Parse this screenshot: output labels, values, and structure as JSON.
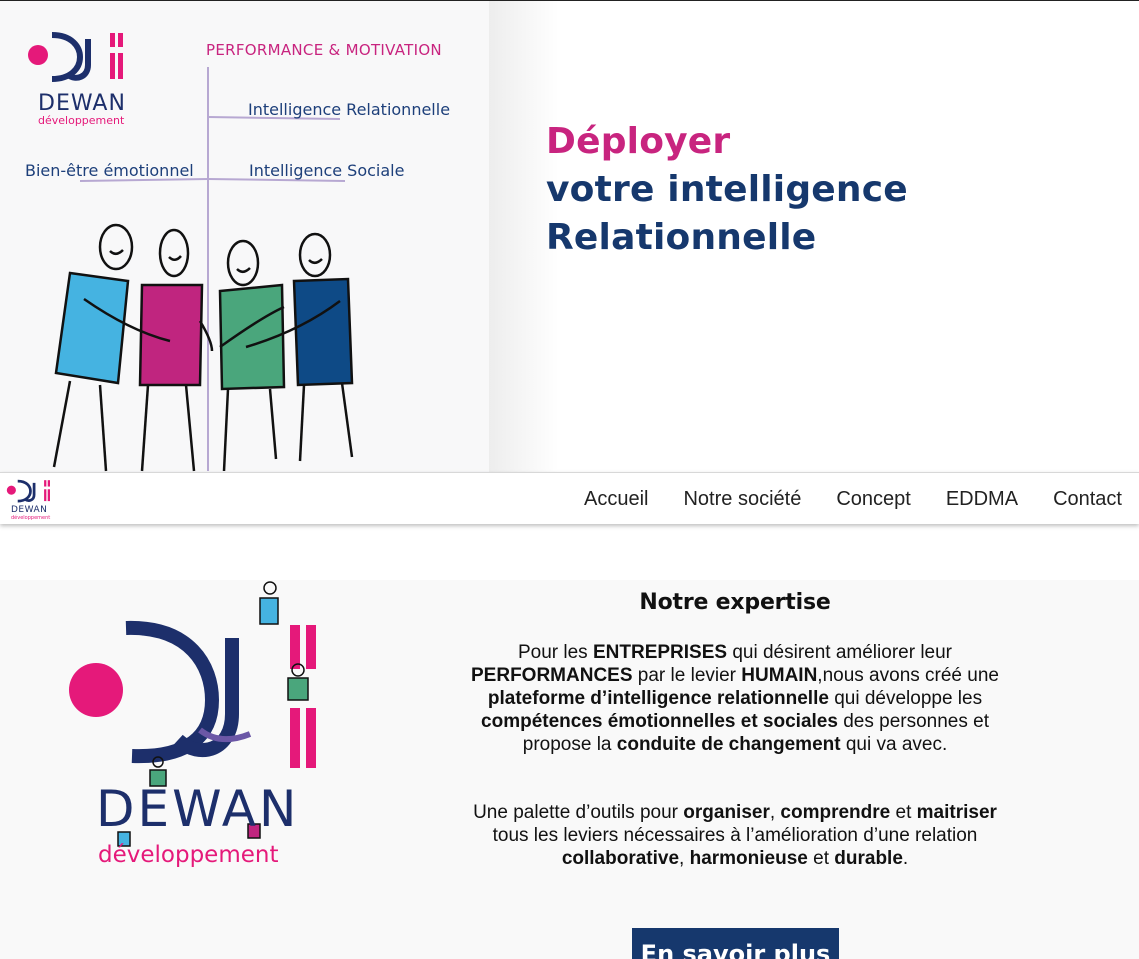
{
  "hero": {
    "illustration": {
      "logo_brand": "DEWAN",
      "logo_sub": "développement",
      "labels": {
        "performance": "PERFORMANCE & MOTIVATION",
        "relationnelle": "Intelligence Relationnelle",
        "bien_etre": "Bien-être émotionnel",
        "sociale": "Intelligence Sociale"
      }
    },
    "title_line1": "Déployer",
    "title_line2": "votre intelligence",
    "title_line3": "Relationnelle"
  },
  "nav": {
    "logo_brand": "DEWAN",
    "logo_sub": "développement",
    "items": [
      {
        "label": "Accueil"
      },
      {
        "label": "Notre société"
      },
      {
        "label": "Concept"
      },
      {
        "label": "EDDMA"
      },
      {
        "label": "Contact"
      }
    ]
  },
  "expertise": {
    "logo_brand": "DEWAN",
    "logo_sub": "développement",
    "title": "Notre expertise",
    "p1": {
      "t1": "Pour les ",
      "b1": "ENTREPRISES",
      "t2": " qui désirent améliorer leur ",
      "b2": "PERFORMANCES",
      "t3": " par le levier ",
      "b3": "HUMAIN",
      "t4": ",nous avons créé une ",
      "b4": "plateforme d’intelligence relationnelle",
      "t5": " qui développe les ",
      "b5": "compétences émotionnelles et sociales",
      "t6": " des personnes et propose la ",
      "b6": "conduite de changement",
      "t7": " qui va avec."
    },
    "p2": {
      "t1": "Une palette d’outils pour ",
      "b1": "organiser",
      "t2": ", ",
      "b2": "comprendre",
      "t3": " et ",
      "b3": "maitriser",
      "t4": " tous les leviers nécessaires à l’amélioration d’une relation ",
      "b4": "collaborative",
      "t5": ", ",
      "b5": "harmonieuse",
      "t6": " et ",
      "b6": "durable",
      "t7": "."
    },
    "cta_label": "En savoir plus"
  },
  "colors": {
    "pink": "#e5197a",
    "magenta": "#c8247f",
    "navy": "#16386d",
    "blue": "#45b3e1",
    "green": "#4aa67c",
    "dark_blue": "#0e4a86"
  }
}
